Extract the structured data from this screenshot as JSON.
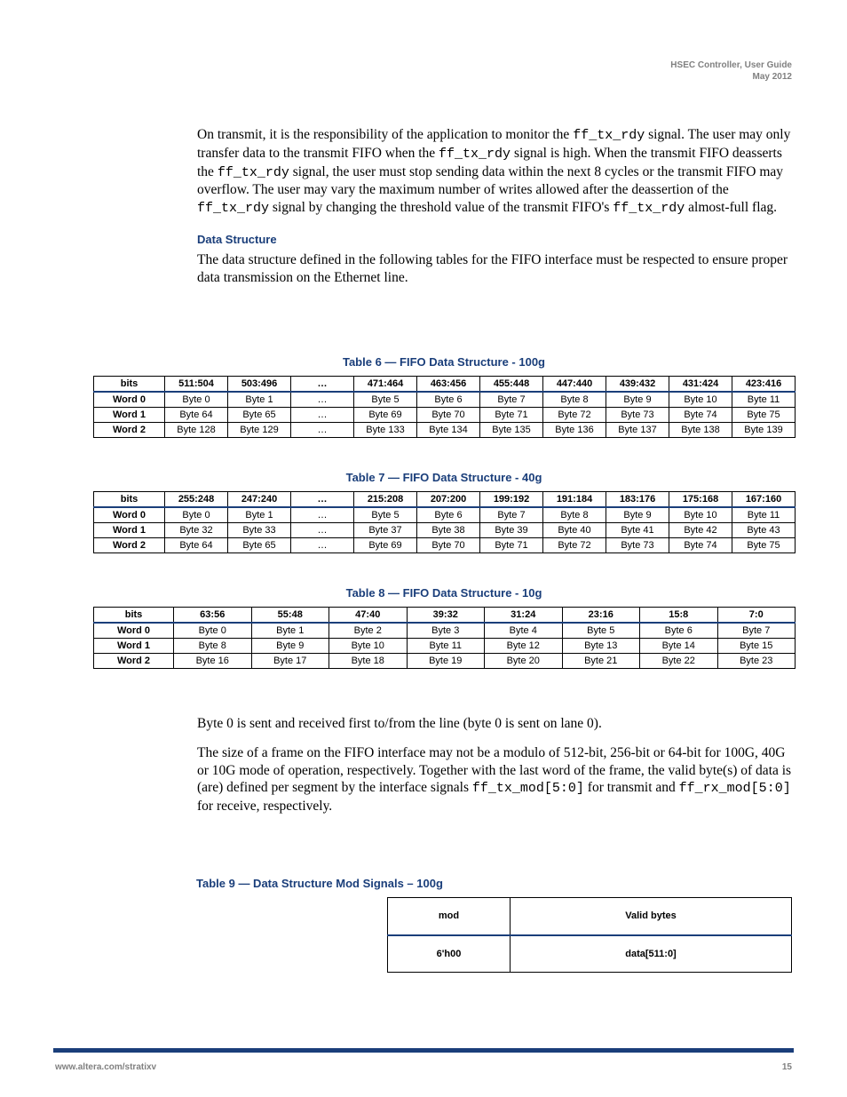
{
  "header": {
    "title": "HSEC Controller, User Guide",
    "subtitle": "May 2012"
  },
  "content": {
    "p1_a": "On transmit, it is the responsibility of the application to monitor the ",
    "p1_c1": "ff_tx_rdy",
    "p1_b": " signal.  The user may only transfer data to the transmit FIFO when the ",
    "p1_c2": "ff_tx_rdy",
    "p1_c": " signal is high.  When the transmit FIFO deasserts the ",
    "p1_c3": "ff_tx_rdy",
    "p1_d": " signal, the user must stop sending data within the next 8 cycles or the transmit FIFO may overflow.  The user may vary the maximum number of writes allowed after the deassertion of the ",
    "p1_c4": "ff_tx_rdy",
    "p1_e": " signal by changing the threshold value of the transmit FIFO's ",
    "p1_c5": "ff_tx_rdy",
    "p1_f": " almost-full flag.",
    "sec_ds": "Data Structure",
    "p2": "The data structure defined in the following tables for the FIFO interface must be respected to ensure proper data transmission on the Ethernet line.",
    "p3": "Byte 0 is sent and received first to/from the line (byte 0 is sent on lane 0).",
    "p4_a": "The size of a frame on the FIFO interface may not be a modulo of 512-bit, 256-bit or 64-bit for 100G, 40G or 10G mode of operation, respectively. Together with the last word of the frame, the valid byte(s) of data is (are) defined per segment by the interface signals ",
    "p4_c1": "ff_tx_mod[5:0]",
    "p4_b": " for transmit and ",
    "p4_c2": "ff_rx_mod[5:0]",
    "p4_c": " for receive, respectively."
  },
  "tables": {
    "t1": {
      "title": "Table 6 — FIFO Data Structure - 100g",
      "headers": [
        "bits",
        "511:504",
        "503:496",
        "…",
        "471:464",
        "463:456",
        "455:448",
        "447:440",
        "439:432",
        "431:424",
        "423:416"
      ],
      "rows": [
        [
          "Word 0",
          "Byte 0",
          "Byte 1",
          "…",
          "Byte 5",
          "Byte 6",
          "Byte 7",
          "Byte 8",
          "Byte 9",
          "Byte 10",
          "Byte 11"
        ],
        [
          "Word 1",
          "Byte 64",
          "Byte 65",
          "…",
          "Byte 69",
          "Byte 70",
          "Byte 71",
          "Byte 72",
          "Byte 73",
          "Byte 74",
          "Byte 75"
        ],
        [
          "Word 2",
          "Byte 128",
          "Byte 129",
          "…",
          "Byte 133",
          "Byte 134",
          "Byte 135",
          "Byte 136",
          "Byte 137",
          "Byte 138",
          "Byte 139"
        ]
      ]
    },
    "t2": {
      "title": "Table 7 — FIFO Data Structure - 40g",
      "headers": [
        "bits",
        "255:248",
        "247:240",
        "…",
        "215:208",
        "207:200",
        "199:192",
        "191:184",
        "183:176",
        "175:168",
        "167:160"
      ],
      "rows": [
        [
          "Word 0",
          "Byte 0",
          "Byte 1",
          "…",
          "Byte 5",
          "Byte 6",
          "Byte 7",
          "Byte 8",
          "Byte 9",
          "Byte 10",
          "Byte 11"
        ],
        [
          "Word 1",
          "Byte 32",
          "Byte 33",
          "…",
          "Byte 37",
          "Byte 38",
          "Byte 39",
          "Byte 40",
          "Byte 41",
          "Byte 42",
          "Byte 43"
        ],
        [
          "Word 2",
          "Byte 64",
          "Byte 65",
          "…",
          "Byte 69",
          "Byte 70",
          "Byte 71",
          "Byte 72",
          "Byte 73",
          "Byte 74",
          "Byte 75"
        ]
      ]
    },
    "t3": {
      "title": "Table 8 — FIFO Data Structure - 10g",
      "headers": [
        "bits",
        "63:56",
        "55:48",
        "47:40",
        "39:32",
        "31:24",
        "23:16",
        "15:8",
        "7:0"
      ],
      "rows": [
        [
          "Word 0",
          "Byte 0",
          "Byte 1",
          "Byte 2",
          "Byte 3",
          "Byte 4",
          "Byte 5",
          "Byte 6",
          "Byte 7"
        ],
        [
          "Word 1",
          "Byte 8",
          "Byte 9",
          "Byte 10",
          "Byte 11",
          "Byte 12",
          "Byte 13",
          "Byte 14",
          "Byte 15"
        ],
        [
          "Word 2",
          "Byte 16",
          "Byte 17",
          "Byte 18",
          "Byte 19",
          "Byte 20",
          "Byte 21",
          "Byte 22",
          "Byte 23"
        ]
      ]
    },
    "t4": {
      "title": "Table 9 — Data Structure Mod Signals – 100g",
      "headers": [
        "mod",
        "Valid bytes"
      ],
      "rows": [
        [
          "6'h00",
          "data[511:0]"
        ]
      ]
    }
  },
  "footer": {
    "left": "www.altera.com/stratixv",
    "right": "15"
  }
}
